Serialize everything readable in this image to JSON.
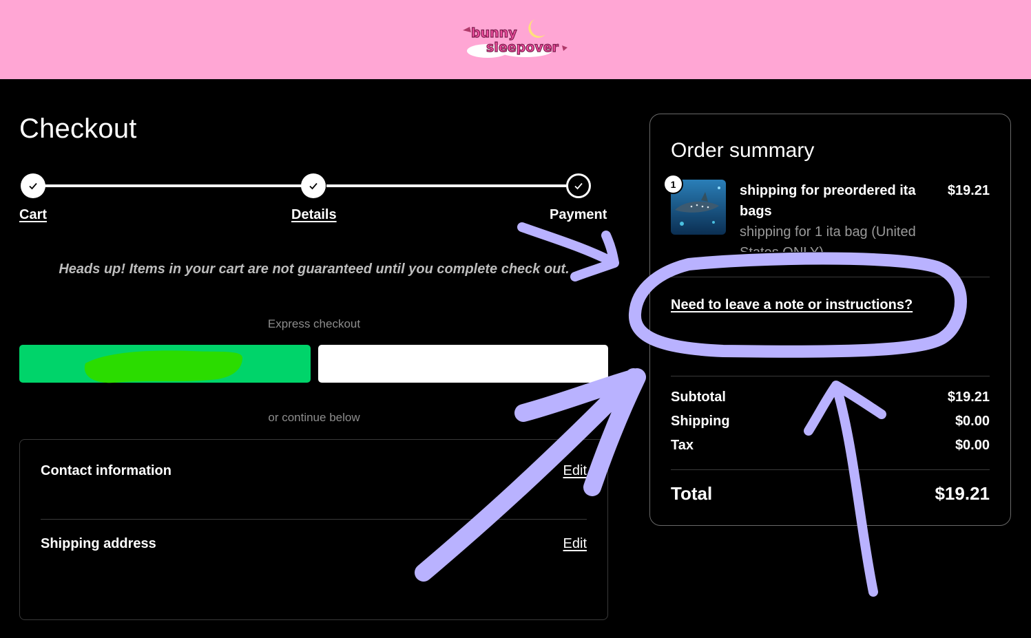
{
  "header": {
    "logo_text_line1": "bunny",
    "logo_text_line2": "sleepover",
    "brand_color": "#ffa6d4"
  },
  "checkout": {
    "title": "Checkout",
    "steps": [
      {
        "label": "Cart",
        "state": "complete"
      },
      {
        "label": "Details",
        "state": "complete"
      },
      {
        "label": "Payment",
        "state": "current"
      }
    ],
    "notice": "Heads up! Items in your cart are not guaranteed until you complete check out.",
    "express_label": "Express checkout",
    "continue_label": "or continue below",
    "sections": [
      {
        "title": "Contact information",
        "edit_label": "Edit"
      },
      {
        "title": "Shipping address",
        "edit_label": "Edit"
      }
    ]
  },
  "summary": {
    "title": "Order summary",
    "item": {
      "quantity": "1",
      "name": "shipping for preordered ita bags",
      "variant": "shipping for 1 ita bag (United States ONLY)",
      "price": "$19.21"
    },
    "note_link": "Need to leave a note or instructions?",
    "subtotal_label": "Subtotal",
    "subtotal_value": "$19.21",
    "shipping_label": "Shipping",
    "shipping_value": "$0.00",
    "tax_label": "Tax",
    "tax_value": "$0.00",
    "total_label": "Total",
    "total_value": "$19.21"
  },
  "colors": {
    "express_green": "#00d46a",
    "annotation_purple": "#b9b2ff",
    "scribble_green": "#2bdc00"
  }
}
